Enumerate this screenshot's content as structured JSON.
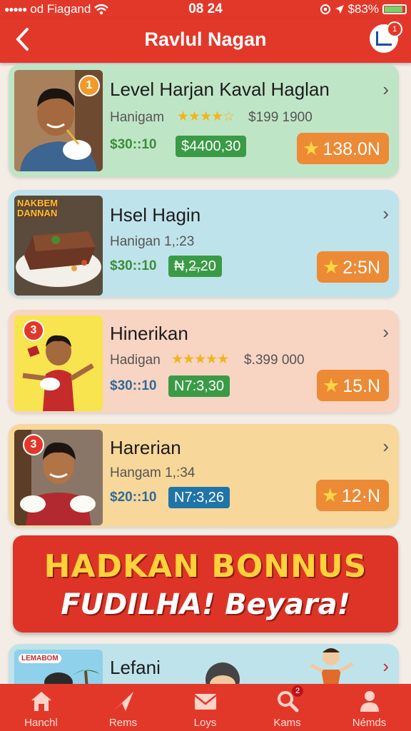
{
  "status": {
    "carrier": "od Fiagand",
    "time": "08 24",
    "battery": "$83%",
    "battery_level": 0.83
  },
  "header": {
    "title": "Ravlul Nagan",
    "notification_count": "1"
  },
  "items": [
    {
      "rank": "1",
      "title": "Level Harjan Kaval Haglan",
      "subtitle": "Hanigam",
      "stars": "★★★★☆",
      "price_right": "$199 1900",
      "price_left": "$30::10",
      "price_badge": "$4400,30",
      "score": "138.0N",
      "thumb_text": ""
    },
    {
      "rank": "",
      "title": "Hsel Hagin",
      "subtitle": "Hanigan 1,:23",
      "stars": "",
      "price_right": "",
      "price_left": "$30::10",
      "price_badge": "₦,2̶,20",
      "score": "2:5N",
      "thumb_text": "NAKBEM DANNAN"
    },
    {
      "rank": "3",
      "title": "Hinerikan",
      "subtitle": "Hadigan",
      "stars": "★★★★★",
      "price_right": "$.399 000",
      "price_left": "$30::10",
      "price_badge": "N7:3,30",
      "score": "15.N",
      "thumb_text": ""
    },
    {
      "rank": "3",
      "title": "Harerian",
      "subtitle": "Hangam 1,:34",
      "stars": "",
      "price_right": "",
      "price_left": "$20::10",
      "price_badge": "N7:3,26",
      "score": "12·N",
      "thumb_text": ""
    }
  ],
  "banner": {
    "line1": "HADKAN BONNUS",
    "line2": "FUDILHA! Beyara!"
  },
  "partial_item": {
    "title": "Lefani",
    "thumb_text": "LEMABOM"
  },
  "tabs": [
    {
      "label": "Hanchl",
      "icon": "home-icon"
    },
    {
      "label": "Rems",
      "icon": "paper-plane-icon"
    },
    {
      "label": "Loys",
      "icon": "envelope-icon"
    },
    {
      "label": "Kams",
      "icon": "search-icon",
      "badge": "2"
    },
    {
      "label": "Némds",
      "icon": "person-icon"
    }
  ],
  "colors": {
    "accent": "#e2382a",
    "card1": "#bfe5c7",
    "card2": "#bfe3ea",
    "card3": "#f8d4c2",
    "card4": "#f7d79a",
    "banner_text": "#ffd23a",
    "score_badge": "#ec8a35"
  }
}
